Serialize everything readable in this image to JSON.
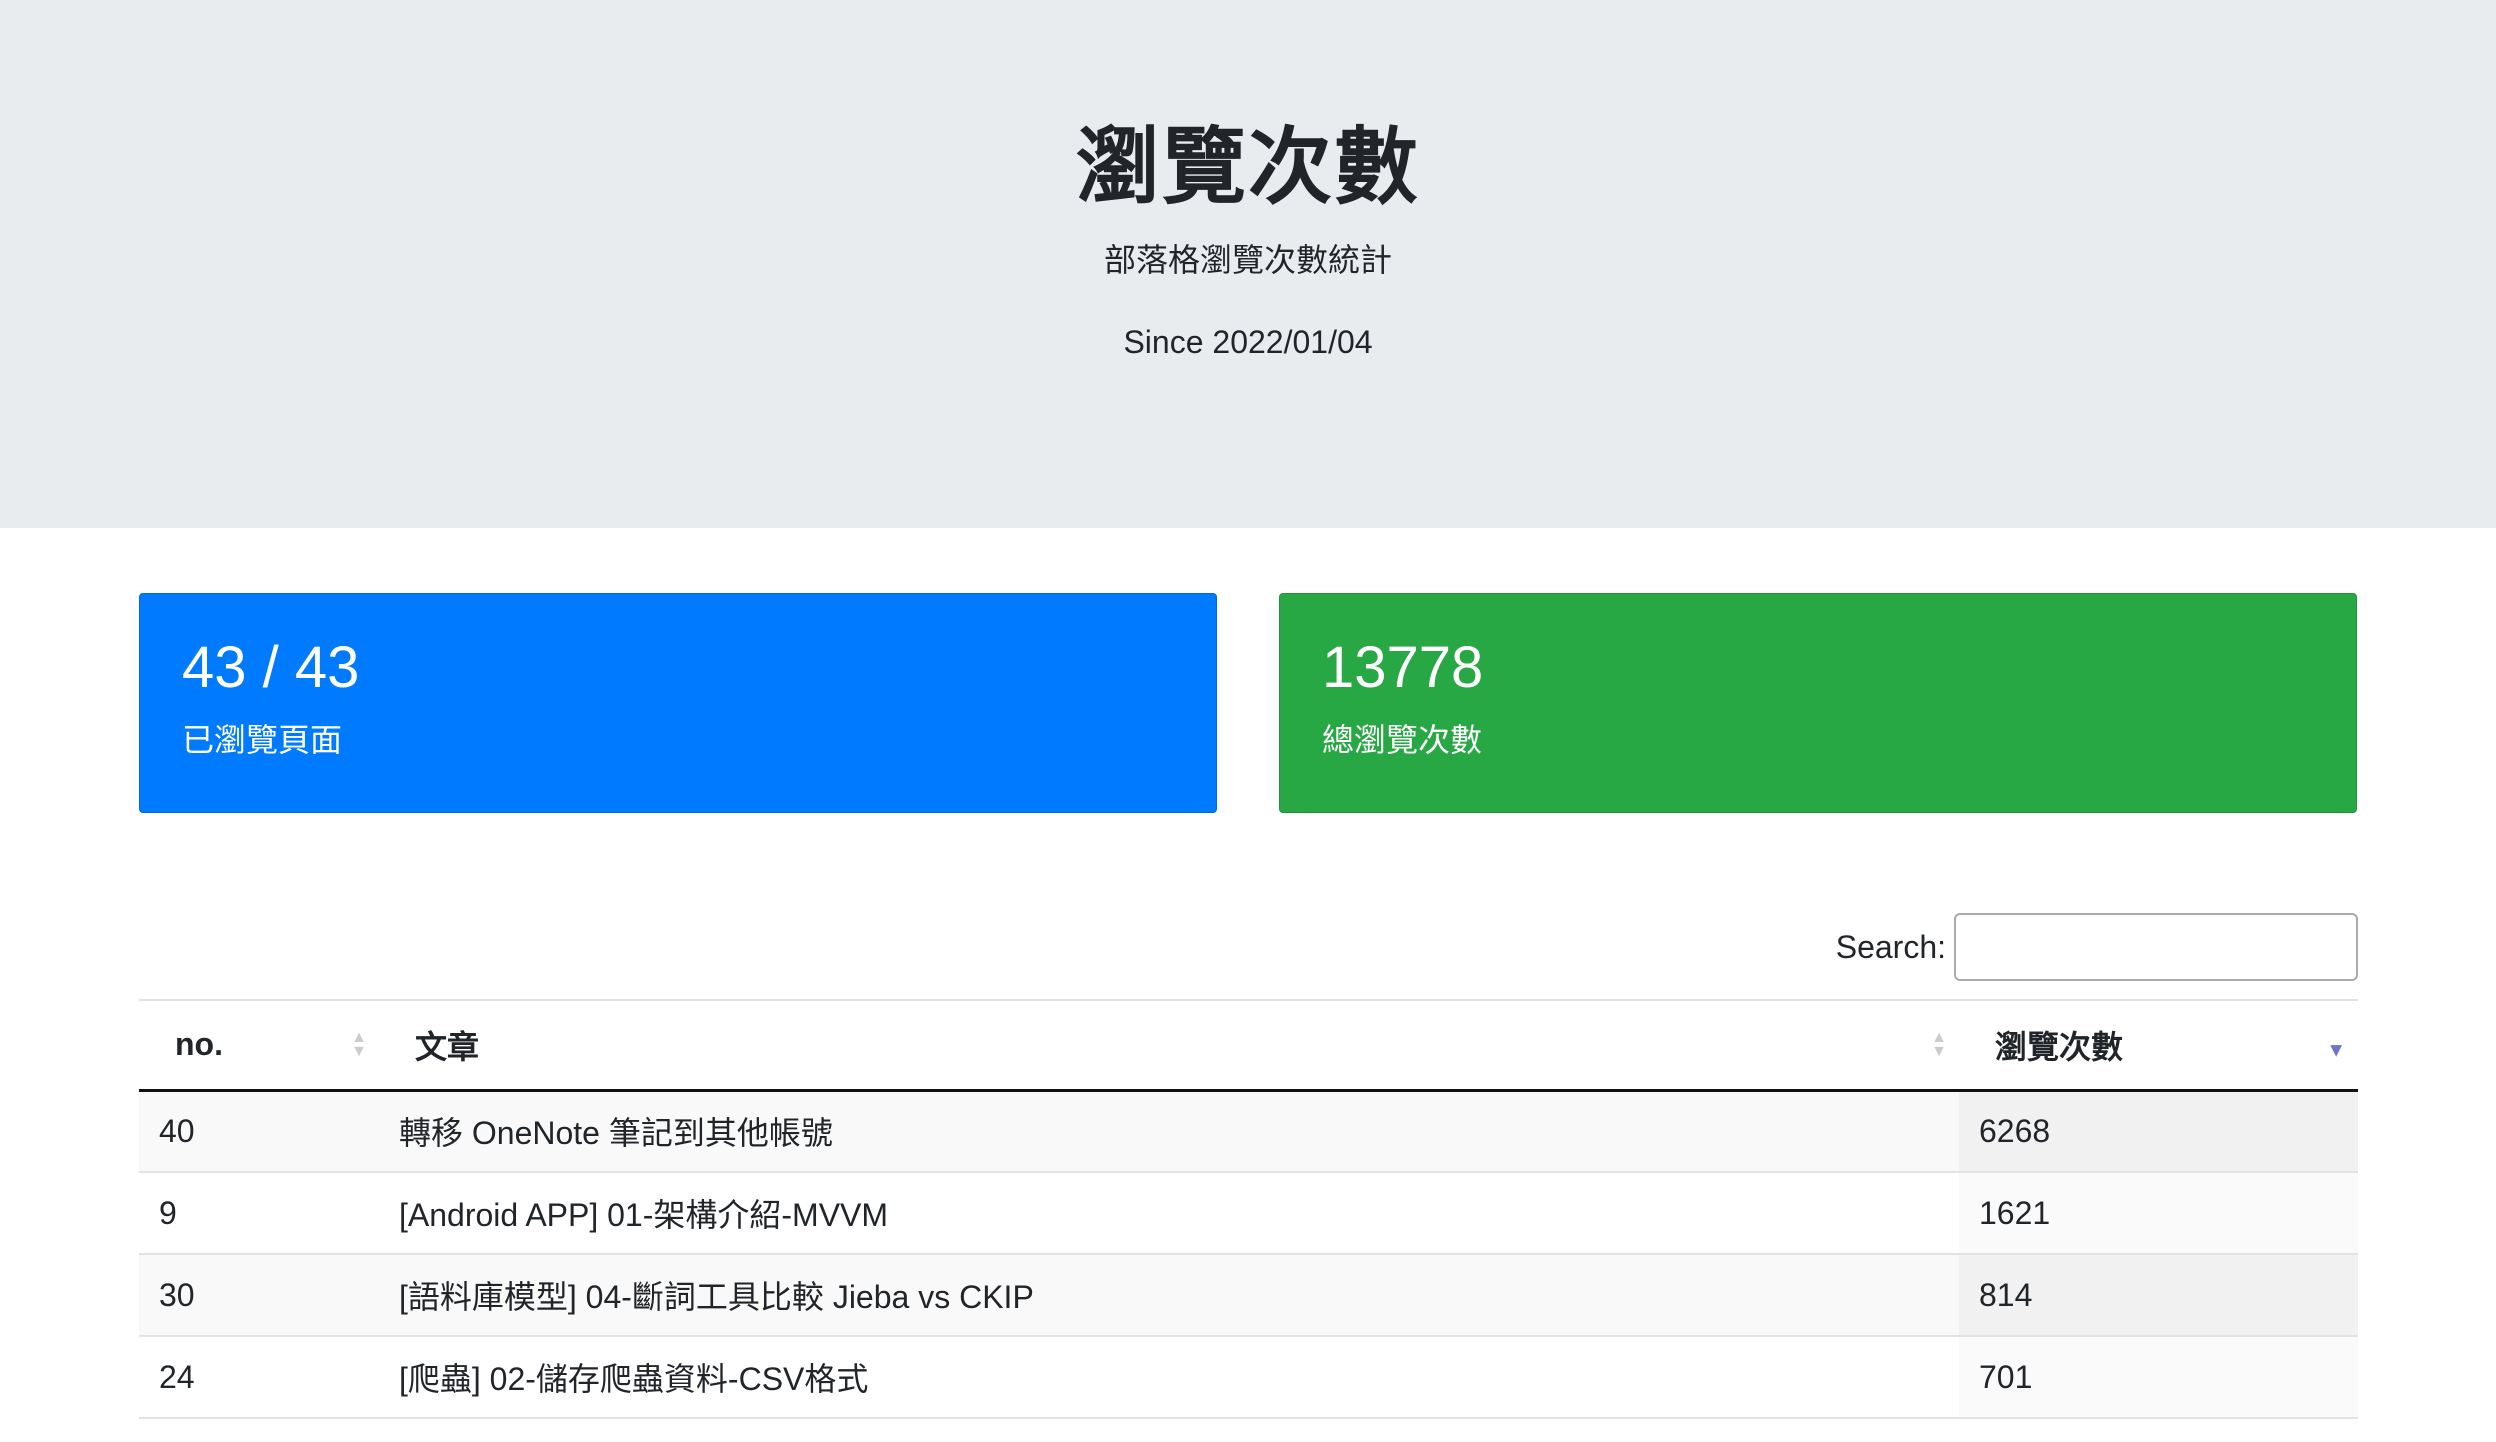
{
  "header": {
    "title": "瀏覽次數",
    "subtitle": "部落格瀏覽次數統計",
    "since": "Since 2022/01/04"
  },
  "stats": [
    {
      "value": "43 / 43",
      "label": "已瀏覽頁面",
      "color": "#007bff"
    },
    {
      "value": "13778",
      "label": "總瀏覽次數",
      "color": "#28a745"
    }
  ],
  "search": {
    "label": "Search:",
    "value": "",
    "placeholder": ""
  },
  "table": {
    "columns": [
      "no.",
      "文章",
      "瀏覽次數"
    ],
    "sorted_column": "瀏覽次數",
    "sort_direction": "descending",
    "rows": [
      {
        "no": "40",
        "title": "轉移 OneNote 筆記到其他帳號",
        "views": "6268"
      },
      {
        "no": "9",
        "title": "[Android APP] 01-架構介紹-MVVM",
        "views": "1621"
      },
      {
        "no": "30",
        "title": "[語料庫模型] 04-斷詞工具比較 Jieba vs CKIP",
        "views": "814"
      },
      {
        "no": "24",
        "title": "[爬蟲] 02-儲存爬蟲資料-CSV格式",
        "views": "701"
      }
    ]
  }
}
